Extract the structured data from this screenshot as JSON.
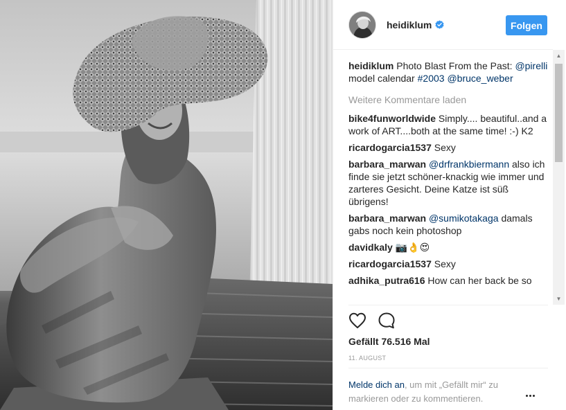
{
  "header": {
    "username": "heidiklum",
    "follow_label": "Folgen"
  },
  "caption": {
    "username": "heidiklum",
    "text": "Photo Blast From the Past:",
    "mention1": "@pirelli",
    "text2": "model calendar",
    "hashtag": "#2003",
    "mention2": "@bruce_weber"
  },
  "load_more": "Weitere Kommentare laden",
  "comments": [
    {
      "user": "bike4funworldwide",
      "text": "Simply.... beautiful..and a work of ART....both at the same time! :-) K2"
    },
    {
      "user": "ricardogarcia1537",
      "text": "Sexy"
    },
    {
      "user": "barbara_marwan",
      "mention": "@drfrankbiermann",
      "text": "also ich finde sie jetzt schöner-knackig wie immer und zarteres Gesicht. Deine Katze ist süß übrigens!"
    },
    {
      "user": "barbara_marwan",
      "mention": "@sumikotakaga",
      "text": "damals gabs noch kein photoshop"
    },
    {
      "user": "davidkaly",
      "text": "📷👌😍"
    },
    {
      "user": "ricardogarcia1537",
      "text": "Sexy"
    },
    {
      "user": "adhika_putra616",
      "text": "How can her back be so"
    }
  ],
  "likes": "Gefällt 76.516 Mal",
  "date": "11. AUGUST",
  "login": {
    "link": "Melde dich an",
    "text": ", um mit „Gefällt mir“ zu markieren oder zu kommentieren."
  },
  "colors": {
    "accent": "#3897f0",
    "link": "#003569",
    "muted": "#999999",
    "text": "#262626"
  },
  "icons": [
    "heart-icon",
    "comment-icon",
    "verified-badge-icon",
    "more-options-icon"
  ]
}
